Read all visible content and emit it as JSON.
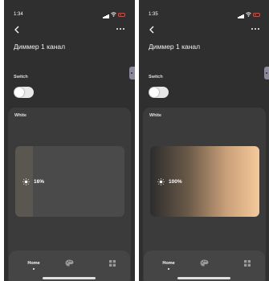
{
  "screens": [
    {
      "status": {
        "time": "1:34"
      },
      "title": "Диммер 1 канал",
      "switch_label": "Switch",
      "switch_on": true,
      "white_label": "White",
      "brightness": {
        "percent_text": "16%",
        "level": 0.16
      },
      "nav": {
        "home_label": "Home",
        "items": [
          "home-icon",
          "palette-icon",
          "grid-icon"
        ]
      }
    },
    {
      "status": {
        "time": "1:35"
      },
      "title": "Диммер 1 канал",
      "switch_label": "Switch",
      "switch_on": true,
      "white_label": "White",
      "brightness": {
        "percent_text": "100%",
        "level": 1.0
      },
      "nav": {
        "home_label": "Home",
        "items": [
          "home-icon",
          "palette-icon",
          "grid-icon"
        ]
      }
    }
  ],
  "colors": {
    "background": "#2f2f2f",
    "card": "#3b3b3b",
    "slider_track": "#4a4a4a",
    "slider_fill_low": "#5a5750",
    "slider_fill_warm": "#f5c99a",
    "battery": "#ff3b30"
  },
  "icons": {
    "back": "chevron-left-icon",
    "more": "more-icon",
    "brightness": "sun-icon",
    "signal": "signal-icon",
    "wifi": "wifi-icon",
    "battery": "battery-icon"
  }
}
